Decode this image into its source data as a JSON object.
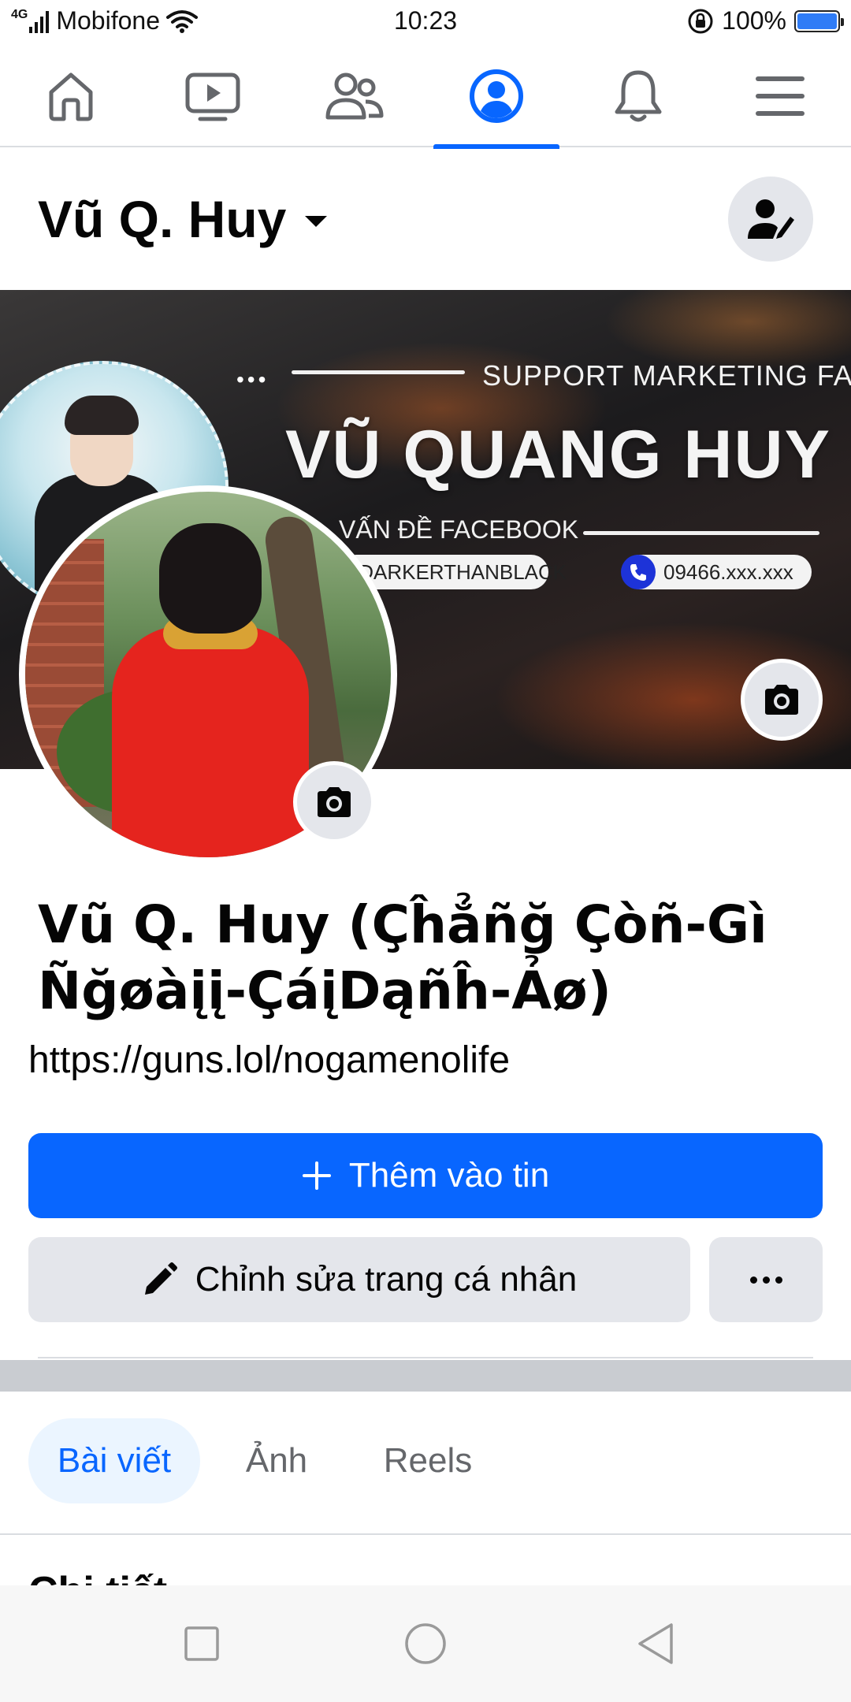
{
  "status_bar": {
    "network": "4G",
    "carrier": "Mobifone",
    "time": "10:23",
    "battery_percent": "100%",
    "battery_level": 1.0
  },
  "top_nav": {
    "items": [
      {
        "icon": "home-icon"
      },
      {
        "icon": "video-icon"
      },
      {
        "icon": "friends-icon"
      },
      {
        "icon": "profile-icon",
        "active": true
      },
      {
        "icon": "bell-icon"
      },
      {
        "icon": "menu-icon"
      }
    ],
    "accent_color": "#0866ff"
  },
  "profile_header": {
    "name": "Vũ Q. Huy",
    "edit_icon": "user-edit-icon"
  },
  "cover": {
    "support_text": "SUPPORT MARKETING FACE",
    "title": "VŨ QUANG HUY",
    "subtitle": "VẤN ĐỀ FACEBOOK",
    "handle": "/DARKERTHANBLACK",
    "phone": "09466.xxx.xxx"
  },
  "profile": {
    "display_name": "Vũ Q. Huy (Çĥẳñğ Çòñ-Gì Ñğøàįį-ÇáįDąñĥ-Ảø)",
    "link": "https://guns.lol/nogamenolife"
  },
  "actions": {
    "add_story_label": "Thêm vào tin",
    "edit_profile_label": "Chỉnh sửa trang cá nhân"
  },
  "tabs": [
    {
      "label": "Bài viết",
      "active": true
    },
    {
      "label": "Ảnh",
      "active": false
    },
    {
      "label": "Reels",
      "active": false
    }
  ],
  "details_heading": "Chi tiết",
  "colors": {
    "primary": "#0866ff",
    "secondary_button": "#e4e6eb",
    "active_tab_bg": "#ebf5ff",
    "battery_fill": "#2f7cf6"
  }
}
